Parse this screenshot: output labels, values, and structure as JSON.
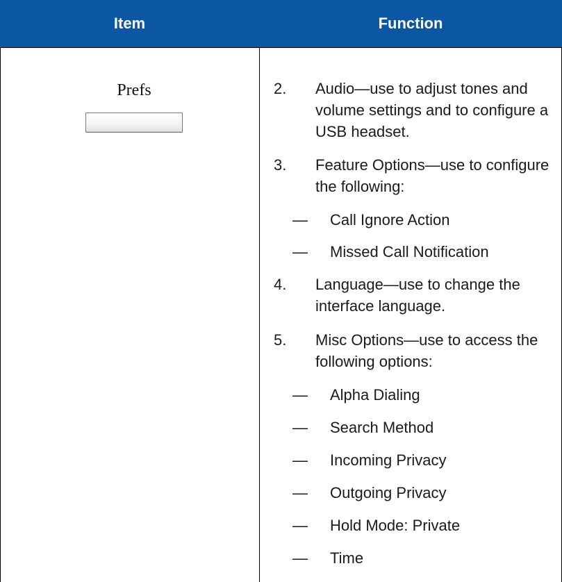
{
  "table": {
    "headers": {
      "item": "Item",
      "function": "Function"
    },
    "item_cell": {
      "label": "Prefs"
    },
    "entries": [
      {
        "num": "2.",
        "text": "Audio—use to adjust tones and volume settings and to configure a USB headset."
      },
      {
        "num": "3.",
        "text": "Feature Options—use to configure the following:"
      },
      {
        "num": "4.",
        "text": "Language—use to change the interface language."
      },
      {
        "num": "5.",
        "text": "Misc Options—use to access the following options:"
      }
    ],
    "feature_options_subitems": [
      {
        "dash": "—",
        "text": "Call Ignore Action"
      },
      {
        "dash": "—",
        "text": "Missed Call Notification"
      }
    ],
    "misc_options_subitems": [
      {
        "dash": "—",
        "text": "Alpha Dialing"
      },
      {
        "dash": "—",
        "text": "Search Method"
      },
      {
        "dash": "—",
        "text": "Incoming Privacy"
      },
      {
        "dash": "—",
        "text": "Outgoing Privacy"
      },
      {
        "dash": "—",
        "text": "Hold Mode: Private"
      },
      {
        "dash": "—",
        "text": "Time"
      }
    ]
  },
  "colors": {
    "header_bg": "#0b57a4",
    "header_text": "#ffffff",
    "rule": "#000000"
  }
}
